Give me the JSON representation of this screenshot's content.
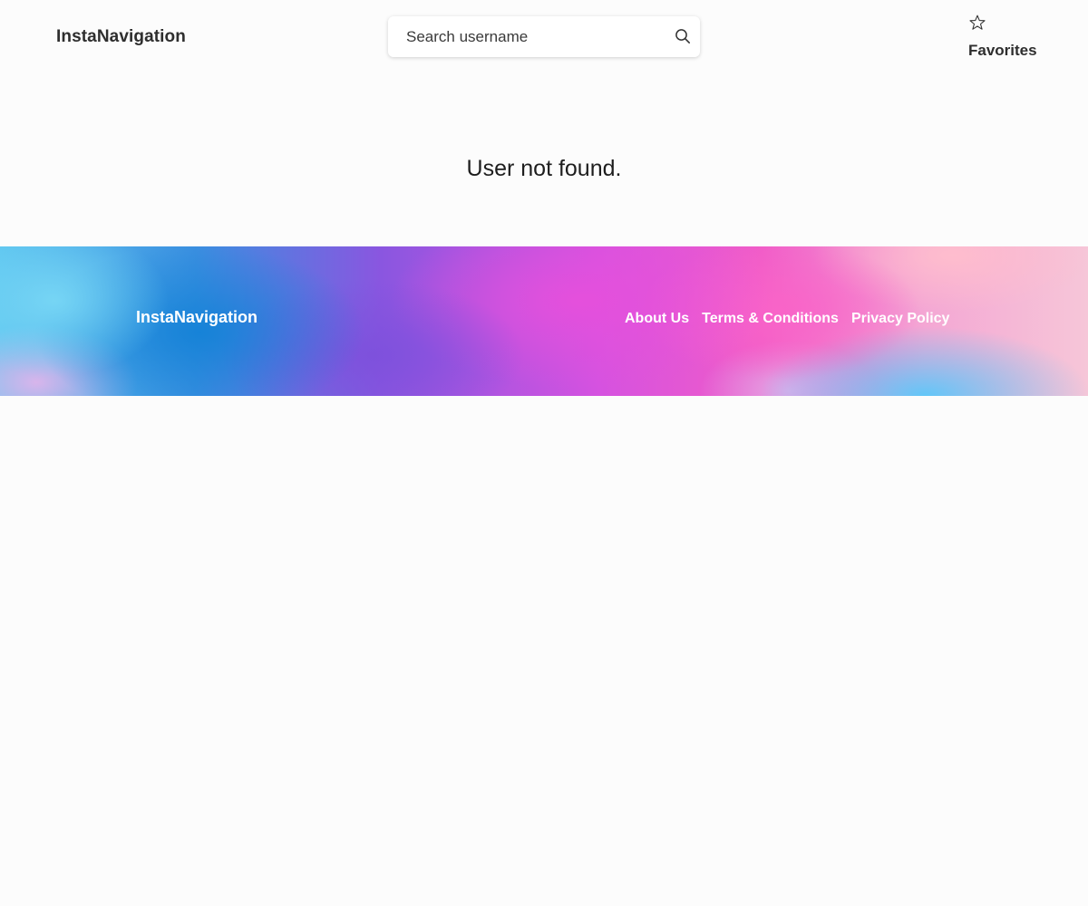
{
  "header": {
    "logo": "InstaNavigation",
    "search": {
      "placeholder": "Search username",
      "value": ""
    },
    "favorites": {
      "label": "Favorites",
      "icon": "star-outline-icon"
    }
  },
  "main": {
    "message": "User not found."
  },
  "footer": {
    "logo": "InstaNavigation",
    "links": [
      {
        "label": "About Us"
      },
      {
        "label": "Terms & Conditions"
      },
      {
        "label": "Privacy Policy"
      }
    ]
  },
  "colors": {
    "background": "#fcfcfc",
    "text": "#2e2e2e",
    "footer_text": "#ffffff"
  }
}
